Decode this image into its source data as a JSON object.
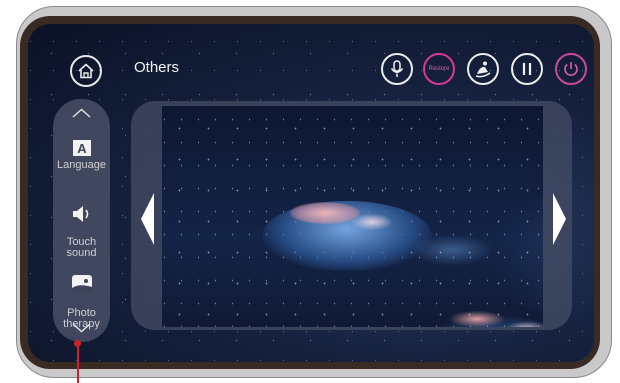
{
  "header": {
    "title": "Others",
    "icons": [
      "home-icon",
      "microphone-icon",
      "restore-icon",
      "massage-chair-icon",
      "pause-icon",
      "power-icon"
    ],
    "restore_label": "Restore"
  },
  "sidebar": {
    "items": [
      {
        "label": "Language",
        "icon": "language-icon"
      },
      {
        "label": "Touch\nsound",
        "icon": "speaker-icon"
      },
      {
        "label": "Photo\ntherapy",
        "icon": "photo-icon"
      }
    ]
  },
  "viewer": {
    "icons": [
      "arrow-left-icon",
      "arrow-right-icon"
    ]
  },
  "colors": {
    "accent_pink": "#d63a96",
    "callout_red": "#d0202a"
  }
}
